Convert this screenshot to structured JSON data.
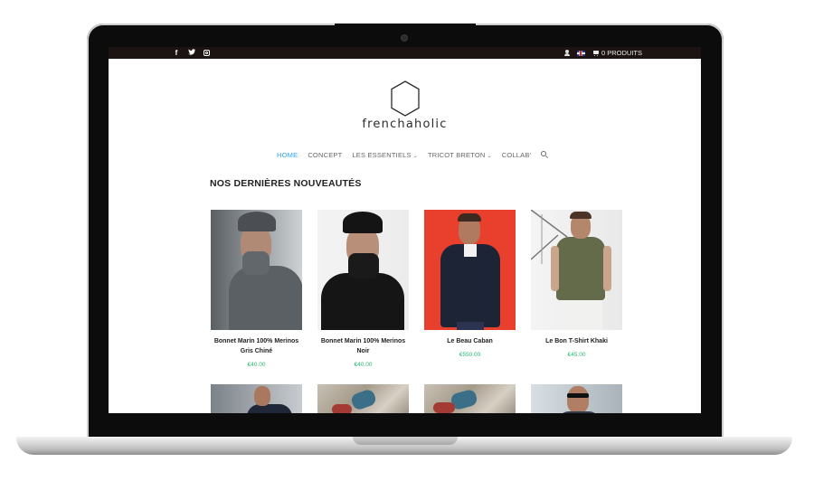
{
  "topbar": {
    "social_icons": [
      "facebook-icon",
      "twitter-icon",
      "instagram-icon"
    ],
    "cart_label": "0 PRODUITS"
  },
  "logo": {
    "text": "frenchaholic"
  },
  "nav": {
    "items": [
      {
        "label": "HOME",
        "active": true
      },
      {
        "label": "CONCEPT"
      },
      {
        "label": "LES ESSENTIELS",
        "dropdown": true
      },
      {
        "label": "TRICOT BRETON",
        "dropdown": true
      },
      {
        "label": "COLLAB'"
      }
    ]
  },
  "section": {
    "title": "NOS DERNIÈRES NOUVEAUTÉS"
  },
  "products": [
    {
      "name": "Bonnet Marin 100% Merinos Gris Chiné",
      "price": "€40.00"
    },
    {
      "name": "Bonnet Marin 100% Merinos Noir",
      "price": "€40.00"
    },
    {
      "name": "Le Beau Caban",
      "price": "€550.00"
    },
    {
      "name": "Le Bon T-Shirt Khaki",
      "price": "€45.00"
    }
  ],
  "colors": {
    "accent_nav": "#2ea3f2",
    "price": "#2bb673",
    "topbar_bg": "#1b1412"
  }
}
